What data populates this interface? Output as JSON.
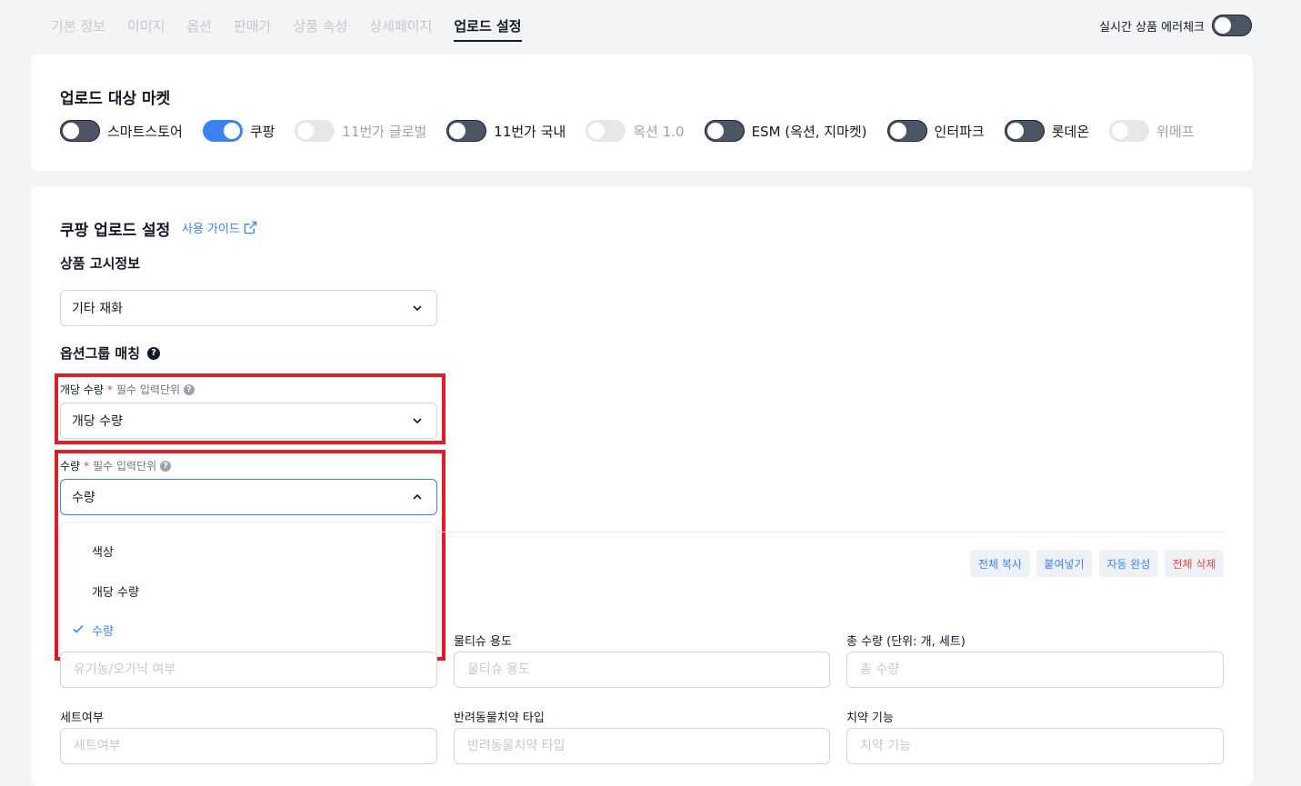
{
  "tabs": [
    {
      "label": "기본 정보"
    },
    {
      "label": "이미지"
    },
    {
      "label": "옵션"
    },
    {
      "label": "판매가"
    },
    {
      "label": "상품 속성"
    },
    {
      "label": "상세페이지"
    },
    {
      "label": "업로드 설정"
    }
  ],
  "error_check": {
    "label": "실시간 상품 에러체크"
  },
  "market_section": {
    "title": "업로드 대상 마켓",
    "markets": [
      {
        "label": "스마트스토어",
        "state": "off"
      },
      {
        "label": "쿠팡",
        "state": "on"
      },
      {
        "label": "11번가 글로벌",
        "state": "disabled"
      },
      {
        "label": "11번가 국내",
        "state": "off"
      },
      {
        "label": "옥션 1.0",
        "state": "disabled"
      },
      {
        "label": "ESM (옥션, 지마켓)",
        "state": "off"
      },
      {
        "label": "인터파크",
        "state": "off"
      },
      {
        "label": "롯데온",
        "state": "off"
      },
      {
        "label": "위메프",
        "state": "disabled"
      }
    ]
  },
  "coupang": {
    "title": "쿠팡 업로드 설정",
    "guide_label": "사용 가이드",
    "notice_title": "상품 고시정보",
    "notice_value": "기타 재화",
    "option_group_title": "옵션그룹 매칭",
    "field1": {
      "label": "개당 수량",
      "required_mark": "*",
      "hint": "필수 입력단위",
      "value": "개당 수량"
    },
    "field2": {
      "label": "수량",
      "required_mark": "*",
      "hint": "필수 입력단위",
      "value": "수량"
    },
    "dropdown_options": [
      {
        "label": "색상",
        "selected": false
      },
      {
        "label": "개당 수량",
        "selected": false
      },
      {
        "label": "수량",
        "selected": true
      }
    ]
  },
  "actions": {
    "copy_all": "전체 복사",
    "paste": "붙여넣기",
    "autocomplete": "자동 완성",
    "delete_all": "전체 삭제"
  },
  "attributes": {
    "organic": {
      "placeholder": "유기농/오가닉 여부"
    },
    "wet_tissue": {
      "label": "물티슈 용도",
      "placeholder": "물티슈 용도"
    },
    "total_qty": {
      "label": "총 수량 (단위: 개, 세트)",
      "placeholder": "총 수량"
    },
    "set": {
      "label": "세트여부",
      "placeholder": "세트여부"
    },
    "pet_toothpaste": {
      "label": "반려동물치약 타입",
      "placeholder": "반려동물치약 타입"
    },
    "toothpaste_function": {
      "label": "치약 기능",
      "placeholder": "치약 기능"
    }
  },
  "colors": {
    "accent": "#3b82f6",
    "danger": "#ef4444",
    "highlight": "#e11d2a"
  }
}
